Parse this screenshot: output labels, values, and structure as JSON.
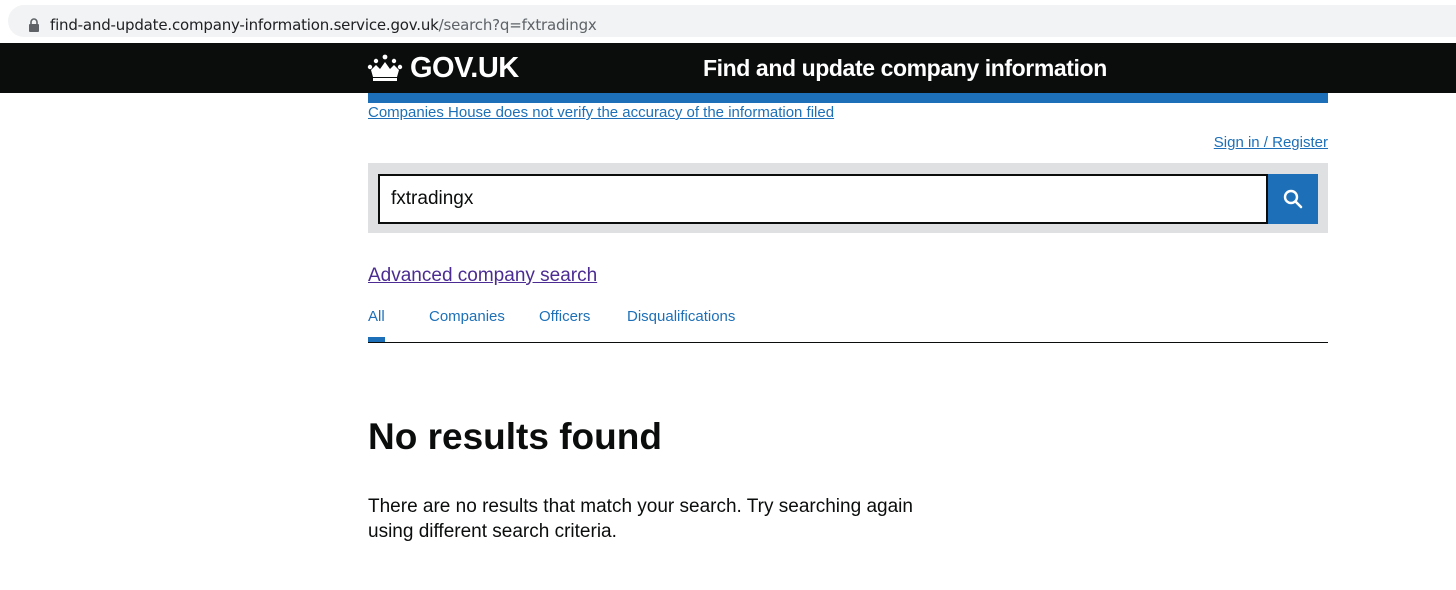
{
  "browser": {
    "url_host": "find-and-update.company-information.service.gov.uk",
    "url_path": "/search?q=fxtradingx"
  },
  "header": {
    "logo_text": "GOV.UK",
    "service_name": "Find and update company information"
  },
  "banner": {
    "accuracy_link": "Companies House does not verify the accuracy of the information filed"
  },
  "account": {
    "sign_in_link": "Sign in / Register"
  },
  "search": {
    "value": "fxtradingx",
    "button_icon": "search-icon"
  },
  "advanced_search_link": "Advanced company search",
  "tabs": [
    {
      "label": "All",
      "active": true
    },
    {
      "label": "Companies",
      "active": false
    },
    {
      "label": "Officers",
      "active": false
    },
    {
      "label": "Disqualifications",
      "active": false
    }
  ],
  "results": {
    "title": "No results found",
    "message": "There are no results that match your search. Try searching again using different search criteria."
  },
  "colors": {
    "header_bg": "#0b0c0c",
    "link_blue": "#1d70b8",
    "visited_purple": "#4c2c92",
    "search_panel_bg": "#dee0e2"
  }
}
